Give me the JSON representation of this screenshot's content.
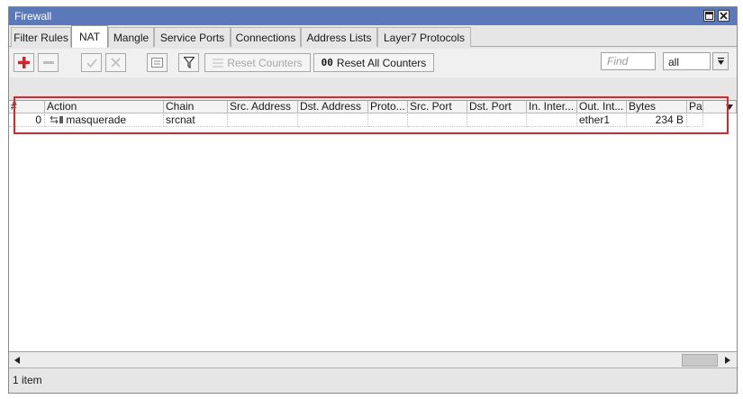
{
  "window": {
    "title": "Firewall"
  },
  "tabs": [
    {
      "label": "Filter Rules",
      "active": false
    },
    {
      "label": "NAT",
      "active": true
    },
    {
      "label": "Mangle",
      "active": false
    },
    {
      "label": "Service Ports",
      "active": false
    },
    {
      "label": "Connections",
      "active": false
    },
    {
      "label": "Address Lists",
      "active": false
    },
    {
      "label": "Layer7 Protocols",
      "active": false
    }
  ],
  "toolbar": {
    "add_icon": "plus-icon",
    "remove_icon": "minus-icon",
    "enable_icon": "check-icon",
    "disable_icon": "x-icon",
    "comment_icon": "note-icon",
    "filter_icon": "funnel-icon",
    "reset_counters_label": "Reset Counters",
    "reset_all_counters_label": "Reset All Counters",
    "reset_all_prefix": "00",
    "find_placeholder": "Find",
    "scope_value": "all"
  },
  "table": {
    "columns": [
      "#",
      "Action",
      "Chain",
      "Src. Address",
      "Dst. Address",
      "Proto...",
      "Src. Port",
      "Dst. Port",
      "In. Inter...",
      "Out. Int...",
      "Bytes",
      "Pa"
    ],
    "rows": [
      {
        "num": "0",
        "action_icon": "masquerade-icon",
        "action": "masquerade",
        "chain": "srcnat",
        "src_address": "",
        "dst_address": "",
        "proto": "",
        "src_port": "",
        "dst_port": "",
        "in_interface": "",
        "out_interface": "ether1",
        "bytes": "234 B",
        "packets": ""
      }
    ]
  },
  "status": {
    "item_count": "1 item"
  },
  "colors": {
    "titlebar": "#5b79b8",
    "highlight": "#d9262b",
    "add_icon": "#d3232a"
  }
}
